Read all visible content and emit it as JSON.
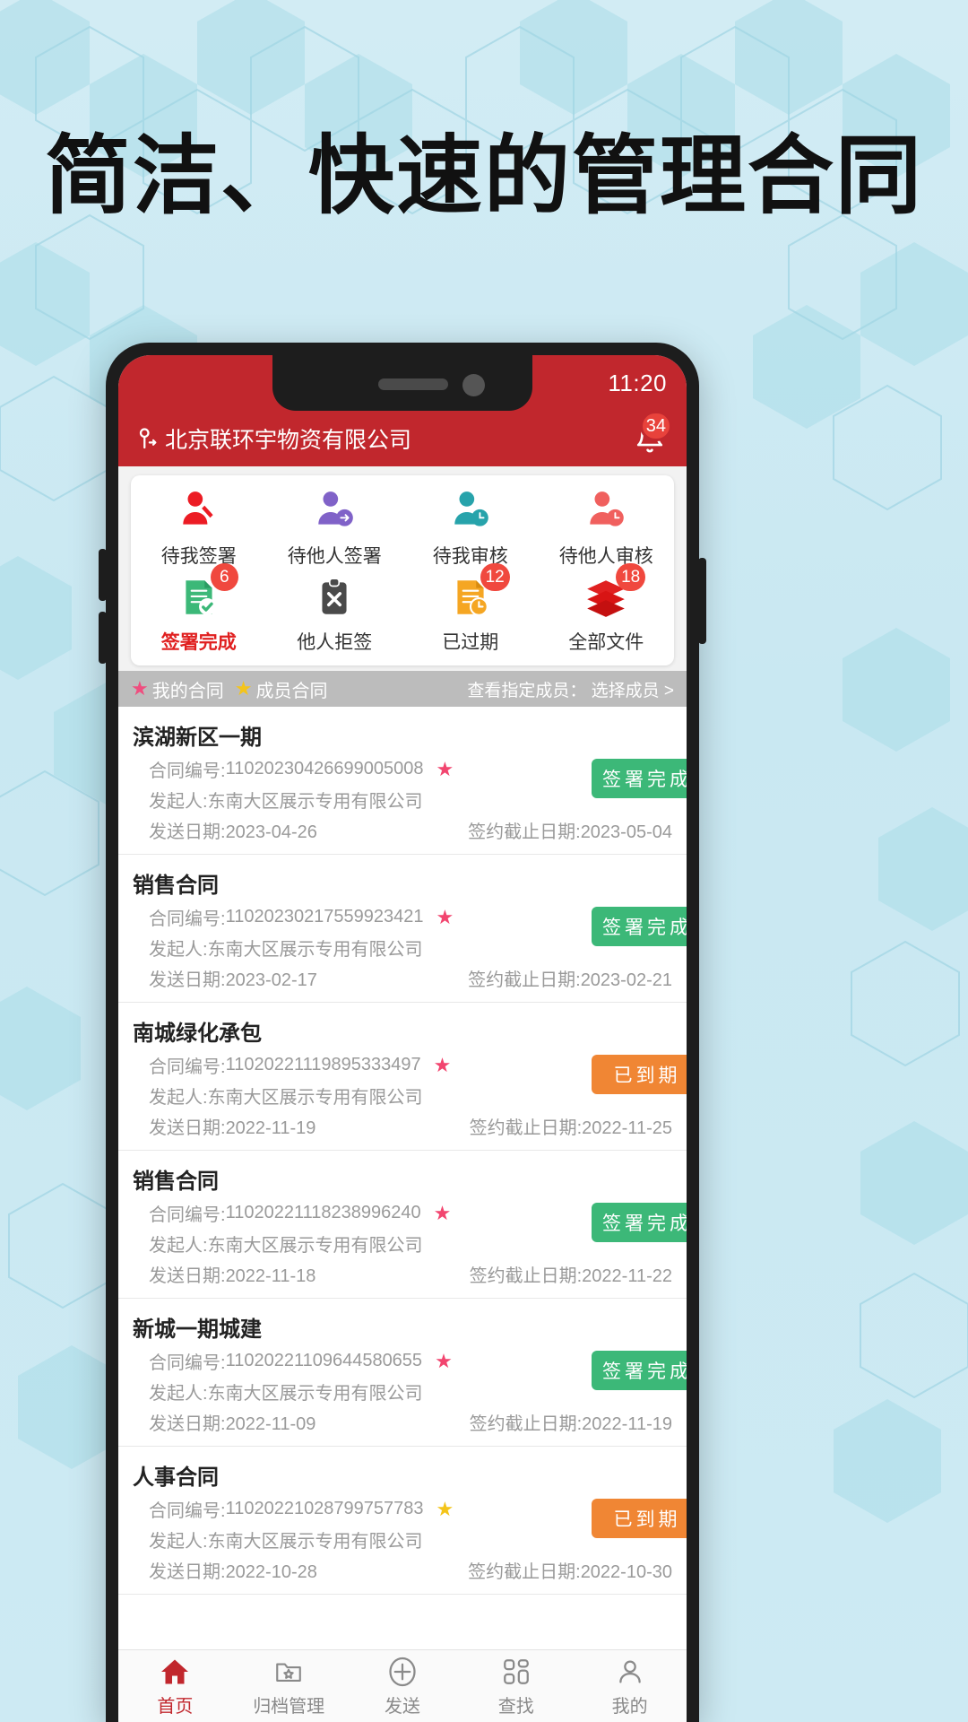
{
  "poster": {
    "headline": "简洁、快速的管理合同"
  },
  "status_bar": {
    "time": "11:20"
  },
  "app_header": {
    "company": "北京联环宇物资有限公司",
    "user_icon": "user-switch-icon",
    "bell_icon": "bell-icon",
    "bell_badge": "34"
  },
  "grid": {
    "row1": [
      {
        "label": "待我签署",
        "icon": "person-sign-icon",
        "color": "#ec1c24",
        "badge": "",
        "active": false
      },
      {
        "label": "待他人签署",
        "icon": "person-arrow-icon",
        "color": "#8062c8",
        "badge": "",
        "active": false
      },
      {
        "label": "待我审核",
        "icon": "person-clock-icon",
        "color": "#27a3ab",
        "badge": "",
        "active": false
      },
      {
        "label": "待他人审核",
        "icon": "person-review-icon",
        "color": "#f0605e",
        "badge": "",
        "active": false
      }
    ],
    "row2": [
      {
        "label": "签署完成",
        "icon": "document-check-icon",
        "color": "#3cb878",
        "badge": "6",
        "active": true
      },
      {
        "label": "他人拒签",
        "icon": "clipboard-x-icon",
        "color": "#4a4a4a",
        "badge": "",
        "active": false
      },
      {
        "label": "已过期",
        "icon": "document-clock-icon",
        "color": "#f5a623",
        "badge": "12",
        "active": false
      },
      {
        "label": "全部文件",
        "icon": "layers-icon",
        "color": "#e02020",
        "badge": "18",
        "active": false
      }
    ]
  },
  "filter_bar": {
    "mine_label": "我的合同",
    "member_label": "成员合同",
    "mine_star": "★",
    "member_star": "★",
    "right_label": "查看指定成员： 选择成员 >"
  },
  "list_labels": {
    "contract_no": "合同编号:",
    "initiator": "发起人:",
    "send_date": "发送日期:",
    "deadline": "签约截止日期:"
  },
  "contracts": [
    {
      "title": "滨湖新区一期",
      "no": "11020230426699005008",
      "initiator": "东南大区展示专用有限公司",
      "send_date": "2023-04-26",
      "deadline": "2023-05-04",
      "status": "签署完成",
      "status_kind": "green",
      "star": "pink"
    },
    {
      "title": "销售合同",
      "no": "11020230217559923421",
      "initiator": "东南大区展示专用有限公司",
      "send_date": "2023-02-17",
      "deadline": "2023-02-21",
      "status": "签署完成",
      "status_kind": "green",
      "star": "pink"
    },
    {
      "title": "南城绿化承包",
      "no": "11020221119895333497",
      "initiator": "东南大区展示专用有限公司",
      "send_date": "2022-11-19",
      "deadline": "2022-11-25",
      "status": "已到期",
      "status_kind": "orange",
      "star": "pink"
    },
    {
      "title": "销售合同",
      "no": "11020221118238996240",
      "initiator": "东南大区展示专用有限公司",
      "send_date": "2022-11-18",
      "deadline": "2022-11-22",
      "status": "签署完成",
      "status_kind": "green",
      "star": "pink"
    },
    {
      "title": "新城一期城建",
      "no": "11020221109644580655",
      "initiator": "东南大区展示专用有限公司",
      "send_date": "2022-11-09",
      "deadline": "2022-11-19",
      "status": "签署完成",
      "status_kind": "green",
      "star": "pink"
    },
    {
      "title": "人事合同",
      "no": "11020221028799757783",
      "initiator": "东南大区展示专用有限公司",
      "send_date": "2022-10-28",
      "deadline": "2022-10-30",
      "status": "已到期",
      "status_kind": "orange",
      "star": "gold"
    }
  ],
  "tabbar": [
    {
      "label": "首页",
      "icon": "home-icon",
      "active": true
    },
    {
      "label": "归档管理",
      "icon": "folder-star-icon",
      "active": false
    },
    {
      "label": "发送",
      "icon": "plus-circle-icon",
      "active": false
    },
    {
      "label": "查找",
      "icon": "grid-search-icon",
      "active": false
    },
    {
      "label": "我的",
      "icon": "person-icon",
      "active": false
    }
  ]
}
